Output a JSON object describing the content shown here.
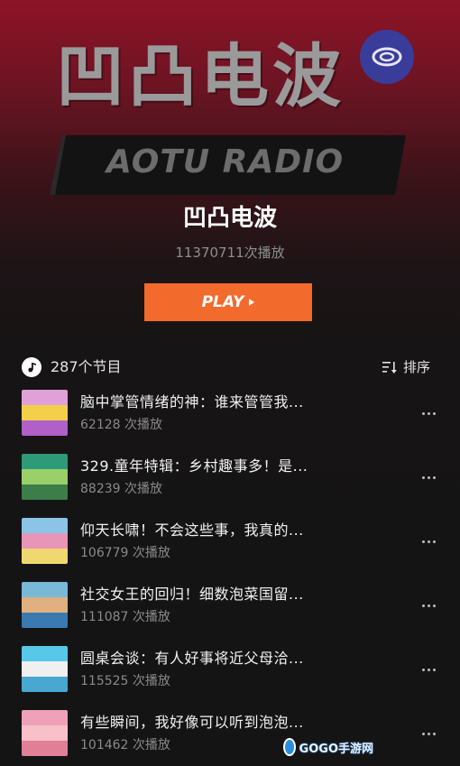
{
  "header": {
    "logo_cn": "凹凸电波",
    "logo_en": "AOTU RADIO",
    "title": "凹凸电波",
    "play_count": "11370711次播放",
    "play_button": "PLAY"
  },
  "list": {
    "count_label": "287个节目",
    "sort_label": "排序",
    "episodes": [
      {
        "title": "脑中掌管情绪的神：谁来管管我...",
        "plays": "62128 次播放",
        "colors": [
          "#e0a0d8",
          "#f3d04a",
          "#b060c8"
        ]
      },
      {
        "title": "329.童年特辑：乡村趣事多！是...",
        "plays": "88239 次播放",
        "colors": [
          "#2e9a7a",
          "#9ad06a",
          "#3c7d4a"
        ]
      },
      {
        "title": "仰天长啸！不会这些事，我真的...",
        "plays": "106779 次播放",
        "colors": [
          "#8cc4e8",
          "#e896b8",
          "#f0d870"
        ]
      },
      {
        "title": "社交女王的回归！细数泡菜国留...",
        "plays": "111087 次播放",
        "colors": [
          "#7ab8d8",
          "#e0b080",
          "#3a7ab0"
        ]
      },
      {
        "title": "圆桌会谈：有人好事将近父母洽...",
        "plays": "115525 次播放",
        "colors": [
          "#58c8e8",
          "#f0f0f0",
          "#48a8d0"
        ]
      },
      {
        "title": "有些瞬间，我好像可以听到泡泡...",
        "plays": "101462 次播放",
        "colors": [
          "#f0a0b8",
          "#f8c0c8",
          "#e08098"
        ]
      }
    ]
  },
  "watermark": {
    "text": "GOGO手游网"
  },
  "colors": {
    "accent": "#f26a2c",
    "background": "#141414",
    "hero_top": "#8c1426"
  }
}
